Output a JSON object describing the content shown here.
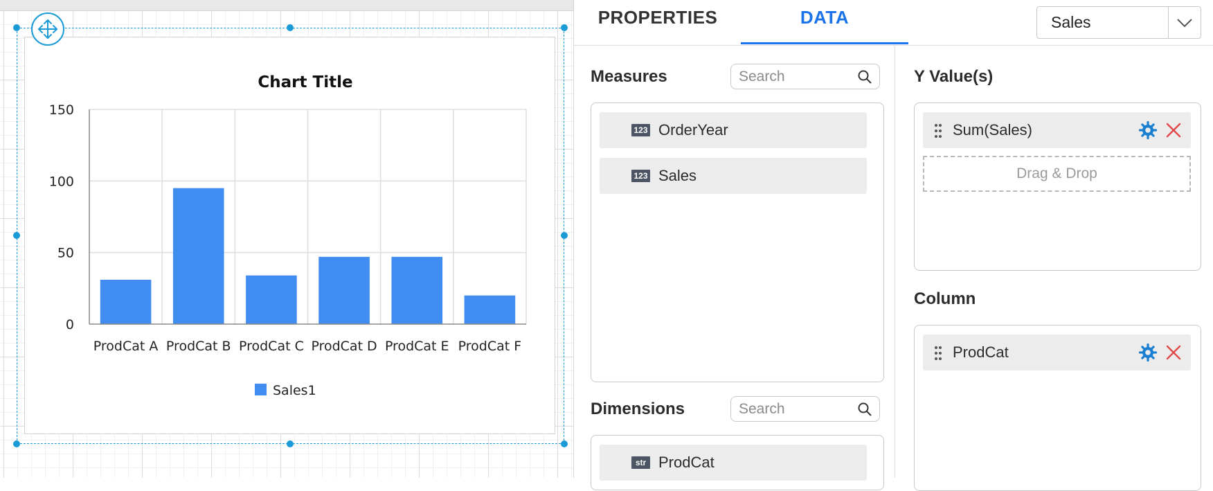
{
  "canvas": {
    "chart": {
      "title": "Chart Title",
      "legend_label": "Sales1",
      "legend_color": "#418cf0"
    }
  },
  "chart_data": {
    "type": "bar",
    "title": "Chart Title",
    "categories": [
      "ProdCat A",
      "ProdCat B",
      "ProdCat C",
      "ProdCat D",
      "ProdCat E",
      "ProdCat F"
    ],
    "series": [
      {
        "name": "Sales1",
        "values": [
          31,
          95,
          34,
          47,
          47,
          20
        ],
        "color": "#418cf0"
      }
    ],
    "ylim": [
      0,
      150
    ],
    "yticks": [
      0,
      50,
      100,
      150
    ],
    "xlabel": "",
    "ylabel": "",
    "grid": true,
    "legend_position": "bottom"
  },
  "panel": {
    "tabs": [
      {
        "label": "PROPERTIES",
        "active": false
      },
      {
        "label": "DATA",
        "active": true
      }
    ],
    "accent_color": "#1a73e8",
    "dataset": {
      "selected": "Sales"
    },
    "measures": {
      "title": "Measures",
      "search_placeholder": "Search",
      "items": [
        {
          "type": "123",
          "label": "OrderYear"
        },
        {
          "type": "123",
          "label": "Sales"
        }
      ]
    },
    "dimensions": {
      "title": "Dimensions",
      "search_placeholder": "Search",
      "items": [
        {
          "type": "str",
          "label": "ProdCat"
        }
      ]
    },
    "y_values": {
      "title": "Y Value(s)",
      "items": [
        {
          "label": "Sum(Sales)"
        }
      ],
      "drop_hint": "Drag & Drop"
    },
    "column": {
      "title": "Column",
      "items": [
        {
          "label": "ProdCat"
        }
      ]
    }
  }
}
